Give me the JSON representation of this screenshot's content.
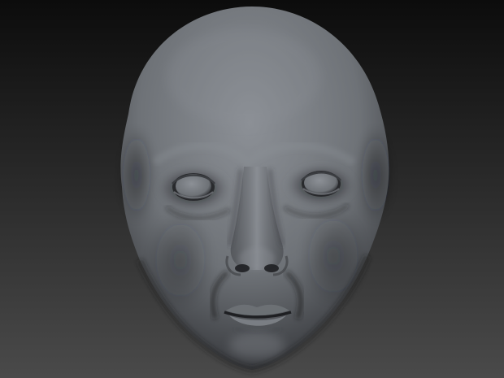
{
  "scene": {
    "subject": "sculpted-head",
    "colors": {
      "background_top": "#0c0c0c",
      "background_bottom": "#4a4a4a",
      "clay_light": "#8c9096",
      "clay_mid": "#6e7277",
      "clay_dark": "#3a3c40",
      "shadow": "#1e1f22"
    }
  }
}
